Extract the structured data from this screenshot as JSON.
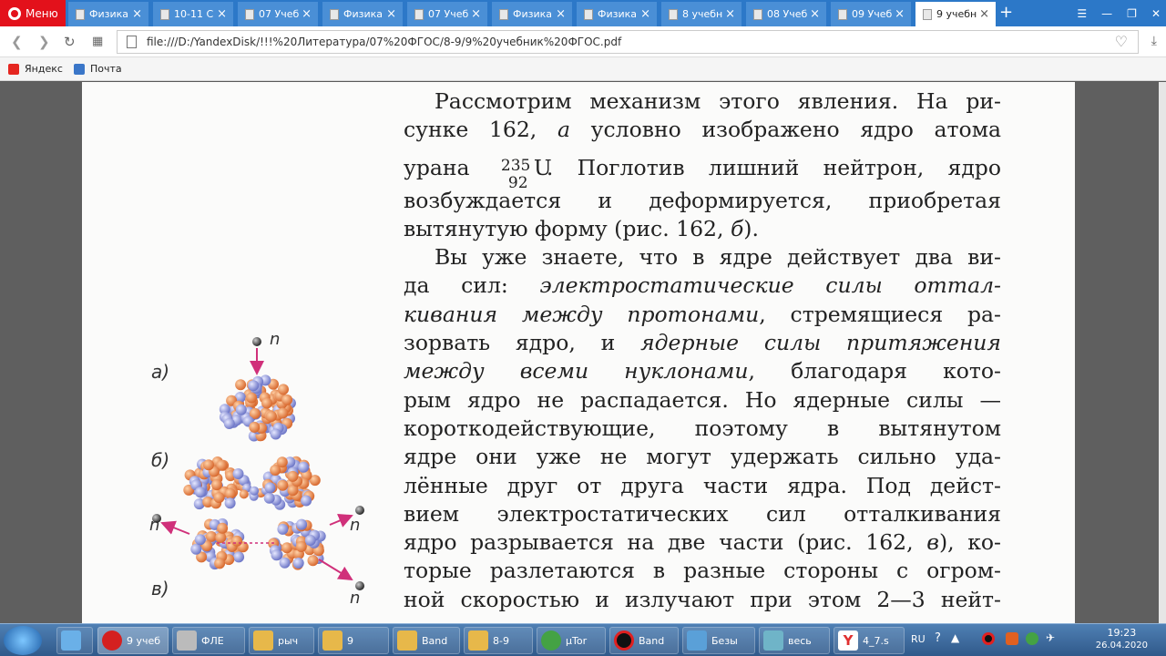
{
  "browser": {
    "menu_label": "Меню",
    "tabs": [
      {
        "label": "Физика"
      },
      {
        "label": "10-11 С"
      },
      {
        "label": "07 Учеб"
      },
      {
        "label": "Физика"
      },
      {
        "label": "07 Учеб"
      },
      {
        "label": "Физика"
      },
      {
        "label": "Физика"
      },
      {
        "label": "8 учебн"
      },
      {
        "label": "08 Учеб"
      },
      {
        "label": "09 Учеб"
      },
      {
        "label": "9 учебн"
      }
    ],
    "active_tab_index": 10,
    "url": "file:///D:/YandexDisk/!!!%20Литература/07%20ФГОС/8-9/9%20учебник%20ФГОС.pdf",
    "bookmarks": [
      {
        "label": "Яндекс",
        "icon": "yandex-icon"
      },
      {
        "label": "Почта",
        "icon": "mail-icon"
      }
    ]
  },
  "document": {
    "figure_labels": {
      "a": "а)",
      "b": "б)",
      "v": "в)",
      "n": "n"
    },
    "paragraph1": {
      "l1": "Рассмотрим механизм этого явления. На ри-",
      "l2a": "сунке 162, ",
      "l2b": "а",
      "l2c": " условно изображено ядро атома",
      "l3a": "урана ",
      "l3_mass": "235",
      "l3_charge": "92",
      "l3_symbol": "U",
      "l3b": ". Поглотив лишний нейтрон, ядро",
      "l4": "возбуждается и деформируется, приобретая",
      "l5a": "вытянутую форму (рис. 162, ",
      "l5b": "б",
      "l5c": ")."
    },
    "paragraph2": {
      "l1": "Вы уже знаете, что в ядре действует два ви-",
      "l2a": "да сил: ",
      "l2b": "электростатические силы оттал-",
      "l3a": "кивания между протонами",
      "l3b": ", стремящиеся ра-",
      "l4a": "зорвать ядро, и ",
      "l4b": "ядерные силы притяжения",
      "l5a": "между всеми нуклонами",
      "l5b": ", благодаря кото-",
      "l6": "рым ядро не распадается. Но ядерные силы —",
      "l7": "короткодействующие, поэтому в вытянутом",
      "l8": "ядре они уже не могут удержать сильно уда-",
      "l9": "лённые друг от друга части ядра. Под дейст-",
      "l10": "вием электростатических сил отталкивания",
      "l11a": "ядро разрывается на две части (рис. 162, ",
      "l11b": "в",
      "l11c": "), ко-",
      "l12": "торые разлетаются в разные стороны с огром-",
      "l13": "ной скоростью и излучают при этом 2—3 нейт-"
    }
  },
  "taskbar": {
    "items": [
      {
        "label": "9 учеб",
        "color": "#d42020"
      },
      {
        "label": "ФЛЕ",
        "color": "#bbbbbb"
      },
      {
        "label": "рыч",
        "color": "#e7b84a"
      },
      {
        "label": "9",
        "color": "#e7b84a"
      },
      {
        "label": "Band",
        "color": "#e7b84a"
      },
      {
        "label": "8-9",
        "color": "#e7b84a"
      },
      {
        "label": "µTor",
        "color": "#44a244"
      },
      {
        "label": "Band",
        "color": "#111111"
      },
      {
        "label": "Безы",
        "color": "#5aa0d8"
      },
      {
        "label": "весь",
        "color": "#6fb4c8"
      },
      {
        "label": "4_7.s",
        "color": "#e03030"
      }
    ],
    "lang": "RU",
    "time": "19:23",
    "date": "26.04.2020"
  }
}
